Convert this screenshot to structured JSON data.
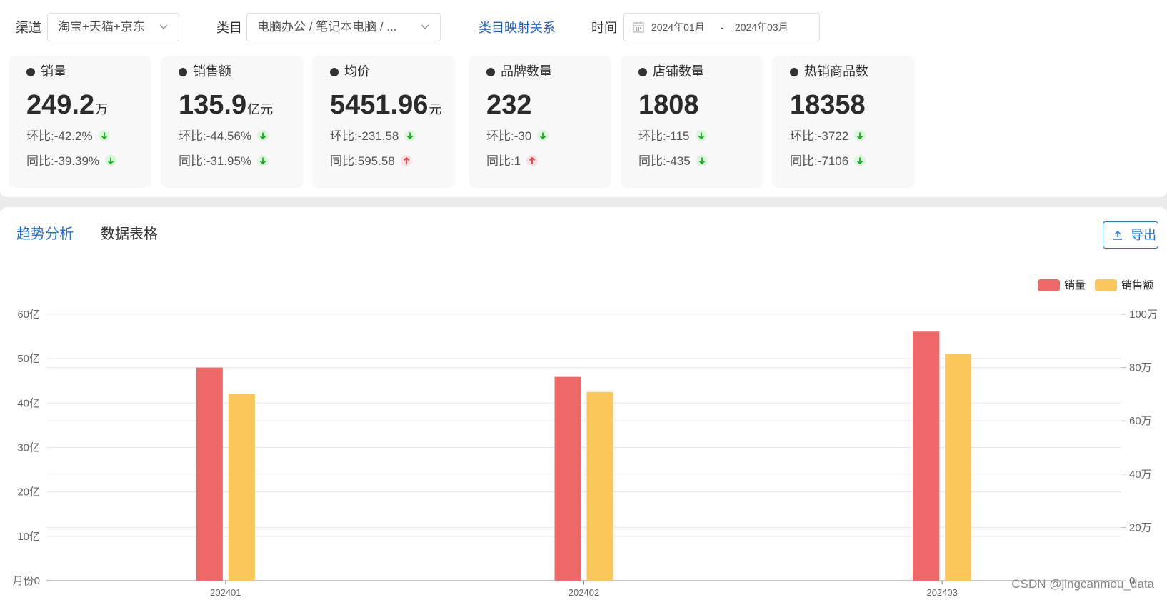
{
  "filters": {
    "channel_label": "渠道",
    "channel_value": "淘宝+天猫+京东",
    "category_label": "类目",
    "category_value": "电脑办公 / 笔记本电脑 / ...",
    "mapping_link": "类目映射关系",
    "time_label": "时间",
    "date_start": "2024年01月",
    "date_sep": "-",
    "date_end": "2024年03月"
  },
  "metrics": [
    {
      "title": "销量",
      "value": "249.2",
      "unit": "万",
      "mom_label": "环比:",
      "mom": "-42.2%",
      "mom_dir": "down",
      "yoy_label": "同比:",
      "yoy": "-39.39%",
      "yoy_dir": "down"
    },
    {
      "title": "销售额",
      "value": "135.9",
      "unit": "亿元",
      "mom_label": "环比:",
      "mom": "-44.56%",
      "mom_dir": "down",
      "yoy_label": "同比:",
      "yoy": "-31.95%",
      "yoy_dir": "down"
    },
    {
      "title": "均价",
      "value": "5451.96",
      "unit": "元",
      "mom_label": "环比:",
      "mom": "-231.58",
      "mom_dir": "down",
      "yoy_label": "同比:",
      "yoy": "595.58",
      "yoy_dir": "up"
    },
    {
      "title": "品牌数量",
      "value": "232",
      "unit": "",
      "mom_label": "环比:",
      "mom": "-30",
      "mom_dir": "down",
      "yoy_label": "同比:",
      "yoy": "1",
      "yoy_dir": "up"
    },
    {
      "title": "店铺数量",
      "value": "1808",
      "unit": "",
      "mom_label": "环比:",
      "mom": "-115",
      "mom_dir": "down",
      "yoy_label": "同比:",
      "yoy": "-435",
      "yoy_dir": "down"
    },
    {
      "title": "热销商品数",
      "value": "18358",
      "unit": "",
      "mom_label": "环比:",
      "mom": "-3722",
      "mom_dir": "down",
      "yoy_label": "同比:",
      "yoy": "-7106",
      "yoy_dir": "down"
    }
  ],
  "tabs": {
    "trend": "趋势分析",
    "table": "数据表格"
  },
  "export_label": "导出",
  "colors": {
    "sales_volume": "#ef6868",
    "sales_amount": "#f9c75a",
    "accent": "#1f6fe0",
    "grid": "#e6e8ef"
  },
  "chart_data": {
    "type": "bar",
    "categories": [
      "202401",
      "202402",
      "202403"
    ],
    "series": [
      {
        "name": "销量",
        "axis": "right",
        "values": [
          80,
          76.5,
          93.5
        ],
        "unit": "万"
      },
      {
        "name": "销售额",
        "axis": "left",
        "values": [
          42,
          42.5,
          51
        ],
        "unit": "亿"
      }
    ],
    "left_axis": {
      "ticks": [
        "月份0",
        "10亿",
        "20亿",
        "30亿",
        "40亿",
        "50亿",
        "60亿"
      ],
      "ylim": [
        0,
        60
      ]
    },
    "right_axis": {
      "ticks": [
        "0",
        "20万",
        "40万",
        "60万",
        "80万",
        "100万"
      ],
      "ylim": [
        0,
        100
      ]
    },
    "legend_position": "top-right",
    "grid": true
  },
  "watermark": "CSDN @jingcanmou_data"
}
